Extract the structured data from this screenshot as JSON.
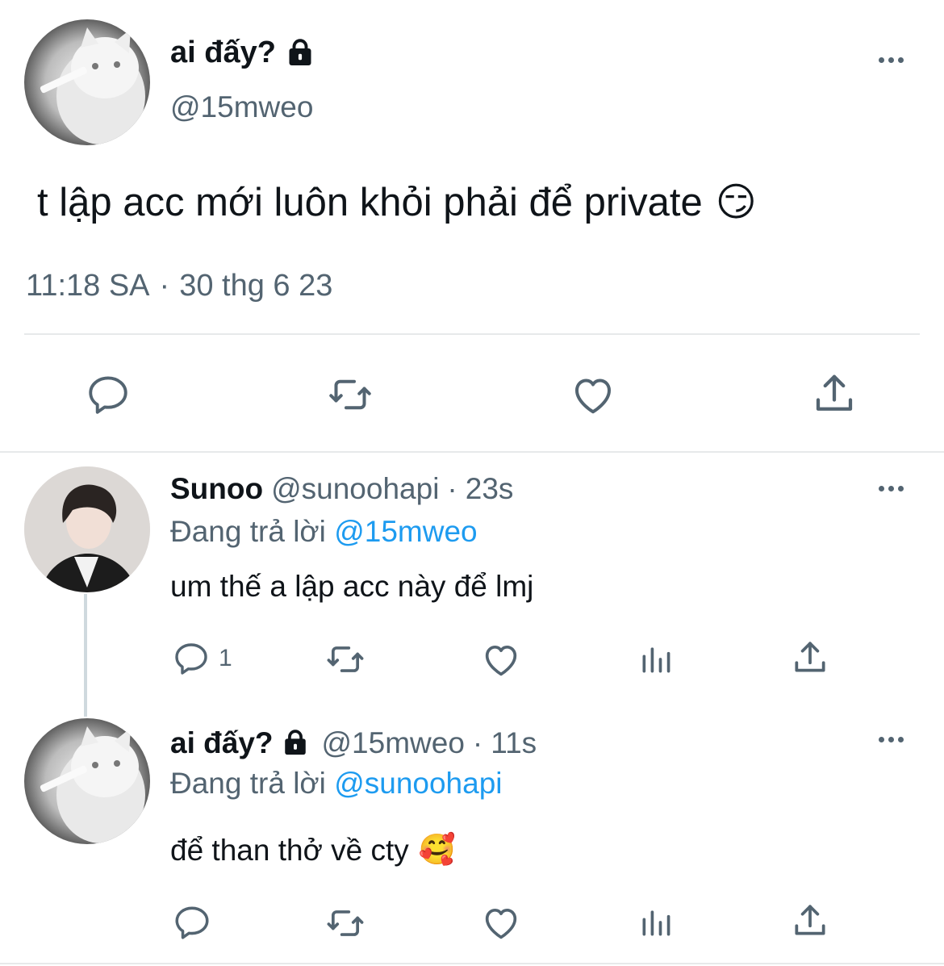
{
  "main_tweet": {
    "display_name": "ai đấy?",
    "handle": "@15mweo",
    "text": "t lập acc mới luôn khỏi phải để private",
    "emoji": "😏",
    "time": "11:18 SA",
    "dot": "·",
    "date": "30 thg 6 23"
  },
  "reply1": {
    "display_name": "Sunoo",
    "handle": "@sunoohapi",
    "dot": "·",
    "age": "23s",
    "replying_prefix": "Đang trả lời",
    "replying_to": "@15mweo",
    "text": "um thế a lập acc này để lmj",
    "reply_count": "1"
  },
  "reply2": {
    "display_name": "ai đấy?",
    "handle": "@15mweo",
    "dot": "·",
    "age": "11s",
    "replying_prefix": "Đang trả lời",
    "replying_to": "@sunoohapi",
    "text": "để than thở về cty",
    "emoji": "🥰"
  },
  "icons": {
    "lock": "lock-icon",
    "more": "more-icon",
    "reply": "reply-icon",
    "retweet": "retweet-icon",
    "like": "heart-icon",
    "share": "share-icon",
    "views": "views-icon"
  },
  "colors": {
    "accent": "#1d9bf0",
    "secondary_text": "#536471",
    "divider": "#e7e9ea"
  }
}
